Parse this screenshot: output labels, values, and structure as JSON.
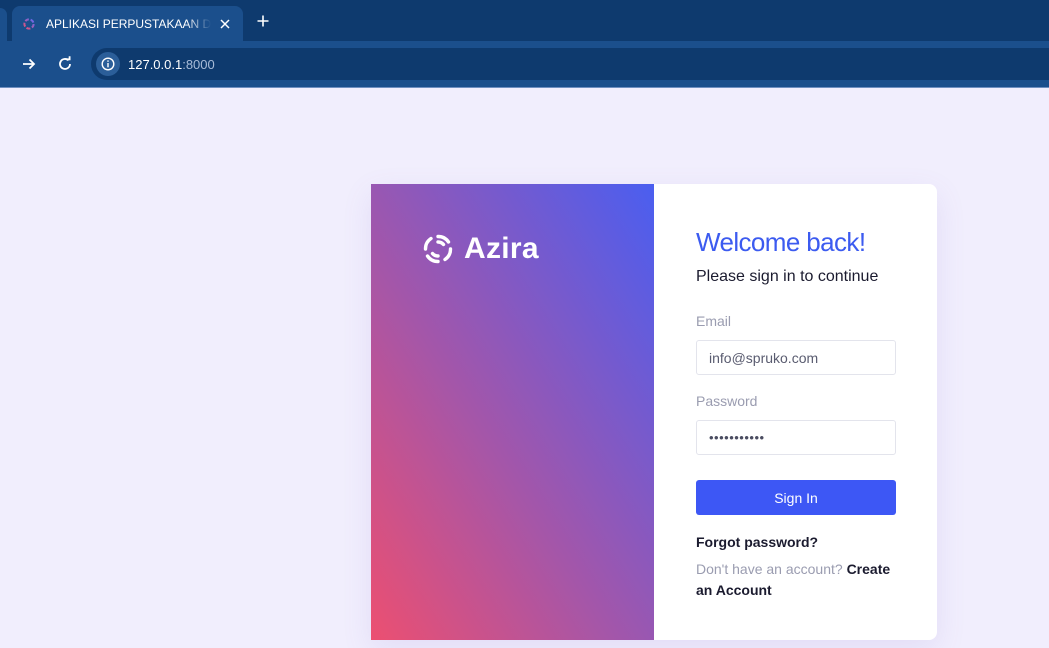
{
  "browser": {
    "tab_title": "APLIKASI PERPUSTAKAAN DIGITAL",
    "close_glyph": "✕",
    "newtab_glyph": "+",
    "url_host": "127.0.0.1",
    "url_port": ":8000",
    "icons": [
      "logo-favicon-icon",
      "close-icon",
      "plus-icon",
      "forward-arrow-icon",
      "reload-icon",
      "info-icon"
    ]
  },
  "brand": {
    "name": "Azira",
    "logo_icon": "azira-logo-icon"
  },
  "login": {
    "heading": "Welcome back!",
    "subheading": "Please sign in to continue",
    "email_label": "Email",
    "email_value": "info@spruko.com",
    "password_label": "Password",
    "password_value": "•••••••••••",
    "signin_label": "Sign In",
    "forgot_label": "Forgot password?",
    "no_account_text": "Don't have an account? ",
    "create_account_label": "Create an Account"
  },
  "colors": {
    "accent": "#3d57f5",
    "heading": "#3c5bf0",
    "gradient_start": "#ec4f71",
    "gradient_mid": "#a556a8",
    "gradient_end": "#4a5ef0",
    "page_bg": "#f1eefd",
    "chrome_dark": "#0e3a6e",
    "chrome_light": "#1b4f8c"
  }
}
